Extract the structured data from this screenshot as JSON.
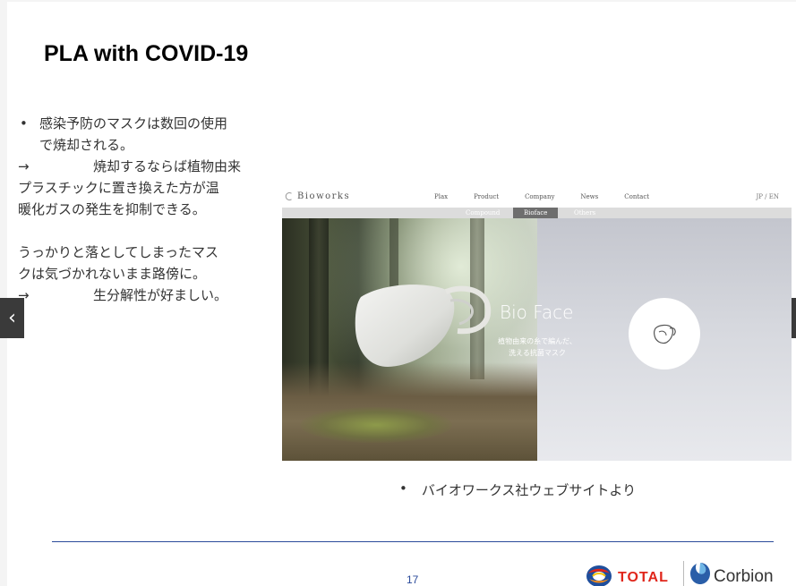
{
  "slide": {
    "title": "PLA with COVID-19",
    "bullet_symbol": "•",
    "arrow_symbol": "→",
    "left_text": {
      "line1": "感染予防のマスクは数回の使用",
      "line2": "で焼却される。",
      "line3_text": "焼却するならば植物由来",
      "line4": "プラスチックに置き換えた方が温",
      "line5": "暖化ガスの発生を抑制できる。",
      "line6": "うっかりと落としてしまったマス",
      "line7": "クは気づかれないまま路傍に。",
      "line8_text": "生分解性が好ましい。"
    },
    "caption": "バイオワークス社ウェブサイトより",
    "page_number": "17",
    "logos": {
      "total": "TOTAL",
      "corbion": "Corbion"
    },
    "nav": {
      "prev_icon": "chevron-left-icon",
      "prev_glyph": "‹"
    }
  },
  "website": {
    "logo": "Bioworks",
    "menu": [
      "Plax",
      "Product",
      "Company",
      "News",
      "Contact"
    ],
    "lang": "JP / EN",
    "submenu": [
      "Compound",
      "Bioface",
      "Others"
    ],
    "active_submenu": "Bioface",
    "hero_title": "Bio Face",
    "hero_sub_line1": "植物由来の糸で編んだ、",
    "hero_sub_line2": "洗える抗菌マスク"
  },
  "colors": {
    "title": "#000000",
    "body_text": "#333333",
    "rule": "#2a4a9a",
    "total_red": "#e0261b",
    "corbion_blue": "#2a5ea8"
  }
}
